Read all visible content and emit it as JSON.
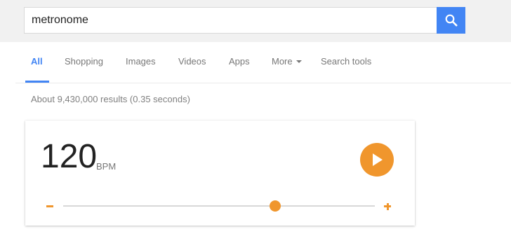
{
  "search": {
    "query": "metronome",
    "button_icon": "search-icon"
  },
  "tabs": [
    {
      "label": "All",
      "active": true
    },
    {
      "label": "Shopping",
      "active": false
    },
    {
      "label": "Images",
      "active": false
    },
    {
      "label": "Videos",
      "active": false
    },
    {
      "label": "Apps",
      "active": false
    },
    {
      "label": "More",
      "active": false,
      "icon": "caret-down-icon"
    },
    {
      "label": "Search tools",
      "active": false
    }
  ],
  "results": {
    "count_text": "About 9,430,000 results (0.35 seconds)"
  },
  "metronome": {
    "tempo": "120",
    "unit": "BPM",
    "play_icon": "play-icon",
    "minus_icon": "minus-icon",
    "plus_icon": "plus-icon",
    "slider_position_fraction": 0.68
  },
  "colors": {
    "accent": "#4285f4",
    "metronome_orange": "#f0962d",
    "top_bar_bg": "#f1f1f1"
  }
}
